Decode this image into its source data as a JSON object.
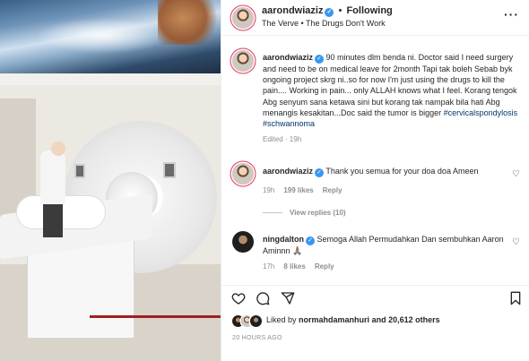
{
  "post": {
    "username": "aarondwiaziz",
    "follow_label": "Following",
    "separator": "•",
    "song": "The Verve • The Drugs Don't Work",
    "more_icon": "more-icon"
  },
  "caption": {
    "username": "aarondwiaziz",
    "text": "90 minutes dlm benda ni. Doctor said I need surgery and need to be on medical leave for 2month Tapi tak boleh Sebab byk ongoing project skrg ni..so for now I'm just using the drugs to kill the pain.... Working in pain... only ALLAH knows what I feel. Korang tengok Abg senyum sana ketawa sini but korang tak nampak bila hati Abg menangis kesakitan...Doc said the tumor is bigger ",
    "hashtags": "#cervicalspondylosis #schwannoma",
    "edited": "Edited · 19h"
  },
  "comments": [
    {
      "username": "aarondwiaziz",
      "text": "Thank you semua for your doa doa Ameen",
      "time": "19h",
      "likes": "199 likes",
      "reply": "Reply"
    },
    {
      "username": "ningdalton",
      "text": "Semoga Allah Permudahkan Dan sembuhkan Aaron Aminnn 🙏🏽",
      "time": "17h",
      "likes": "8 likes",
      "reply": "Reply"
    }
  ],
  "view_replies": "View replies (10)",
  "likes": {
    "prefix": "Liked by",
    "user": "normahdamanhuri",
    "suffix": "and 20,612 others"
  },
  "timestamp": "20 HOURS AGO",
  "colors": {
    "hashtag": "#00376b",
    "verified": "#3897f0",
    "story_ring": "#e3355f",
    "muted": "#8e8e8e"
  }
}
